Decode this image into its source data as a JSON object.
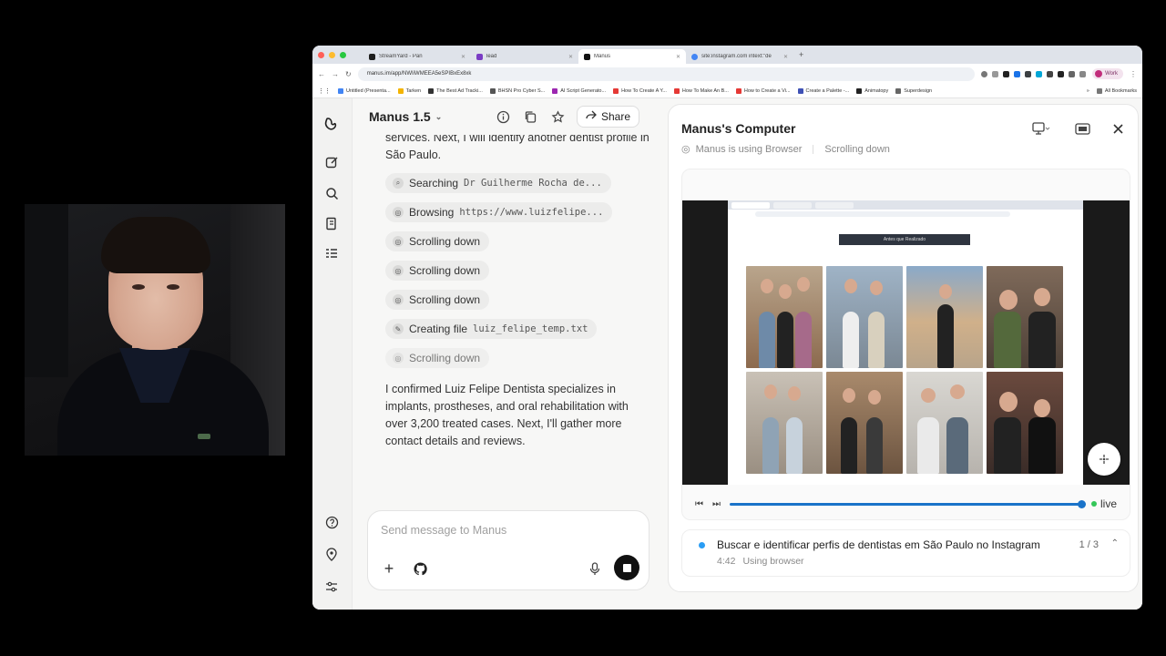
{
  "browser": {
    "tabs": [
      {
        "title": "StreamYard - Pan",
        "color": "#1e1e1e"
      },
      {
        "title": "lead",
        "color": "#7a3cc4"
      },
      {
        "title": "Manus",
        "color": "#111111"
      },
      {
        "title": "site:instagram.com intext:\"de",
        "color": "#4285f4"
      }
    ],
    "url": "manus.im/app/NWIiWMEEA5eSPIBxEx8xk",
    "profile_label": "Work",
    "bookmarks": [
      {
        "label": "Untitled (Presenta...",
        "color": "#4285f4"
      },
      {
        "label": "Tarken",
        "color": "#f4b400"
      },
      {
        "label": "The Best Ad Tracki...",
        "color": "#333333"
      },
      {
        "label": "BHSN Pro Cyber S...",
        "color": "#555555"
      },
      {
        "label": "AI Script Generato...",
        "color": "#9c27b0"
      },
      {
        "label": "How To Create A Y...",
        "color": "#e53935"
      },
      {
        "label": "How To Make An B...",
        "color": "#e53935"
      },
      {
        "label": "How to Create a Vi...",
        "color": "#e53935"
      },
      {
        "label": "Create a Palette -...",
        "color": "#3f51b5"
      },
      {
        "label": "Animatopy",
        "color": "#222222"
      },
      {
        "label": "Superdesign",
        "color": "#666666"
      }
    ],
    "all_bookmarks": "All Bookmarks"
  },
  "chat": {
    "model": "Manus 1.5",
    "share_label": "Share",
    "partial_text": "services. Next, I will identify another dentist profile in São Paulo.",
    "steps": [
      {
        "icon": "search-icon",
        "action": "Searching",
        "arg": "Dr Guilherme Rocha de..."
      },
      {
        "icon": "browser-icon",
        "action": "Browsing",
        "arg": "https://www.luizfelipe..."
      },
      {
        "icon": "browser-icon",
        "action": "Scrolling down",
        "arg": ""
      },
      {
        "icon": "browser-icon",
        "action": "Scrolling down",
        "arg": ""
      },
      {
        "icon": "browser-icon",
        "action": "Scrolling down",
        "arg": ""
      },
      {
        "icon": "edit-icon",
        "action": "Creating file",
        "arg": "luiz_felipe_temp.txt"
      },
      {
        "icon": "browser-icon",
        "action": "Scrolling down",
        "arg": ""
      }
    ],
    "message": "I confirmed Luiz Felipe Dentista specializes in implants, prostheses, and oral rehabilitation with over 3,200 treated cases. Next, I'll gather more contact details and reviews.",
    "input_placeholder": "Send message to Manus"
  },
  "computer": {
    "title": "Manus's Computer",
    "status_tool": "Manus is using Browser",
    "status_action": "Scrolling down",
    "banner_text": "Antes que Realizado",
    "progress": 1.0,
    "live_label": "live",
    "task_title": "Buscar e identificar perfis de dentistas em São Paulo no Instagram",
    "task_time": "4:42",
    "task_status": "Using browser",
    "task_count": "1 / 3"
  }
}
